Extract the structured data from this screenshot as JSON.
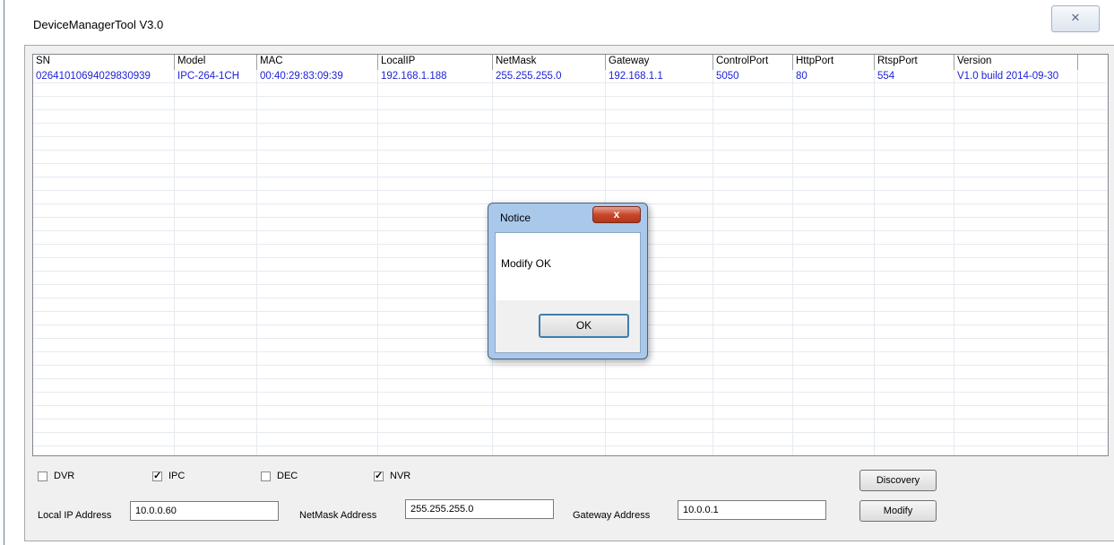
{
  "window": {
    "title": "DeviceManagerTool V3.0",
    "close_glyph": "✕"
  },
  "table": {
    "columns": [
      "SN",
      "Model",
      "MAC",
      "LocalIP",
      "NetMask",
      "Gateway",
      "ControlPort",
      "HttpPort",
      "RtspPort",
      "Version"
    ],
    "rows": [
      [
        "02641010694029830939",
        "IPC-264-1CH",
        "00:40:29:83:09:39",
        "192.168.1.188",
        "255.255.255.0",
        "192.168.1.1",
        "5050",
        "80",
        "554",
        "V1.0 build 2014-09-30"
      ]
    ]
  },
  "filters": {
    "dvr": {
      "label": "DVR",
      "checked": false
    },
    "ipc": {
      "label": "IPC",
      "checked": true
    },
    "dec": {
      "label": "DEC",
      "checked": false
    },
    "nvr": {
      "label": "NVR",
      "checked": true
    }
  },
  "form": {
    "local_ip_label": "Local IP Address",
    "local_ip_value": "10.0.0.60",
    "netmask_label": "NetMask Address",
    "netmask_value": "255.255.255.0",
    "gateway_label": "Gateway Address",
    "gateway_value": "10.0.0.1"
  },
  "buttons": {
    "discovery": "Discovery",
    "modify": "Modify"
  },
  "dialog": {
    "title": "Notice",
    "message": "Modify OK",
    "ok": "OK",
    "close_glyph": "x"
  },
  "colors": {
    "row_text": "#1f23d6",
    "dialog_frame": "#a9c8ea"
  }
}
